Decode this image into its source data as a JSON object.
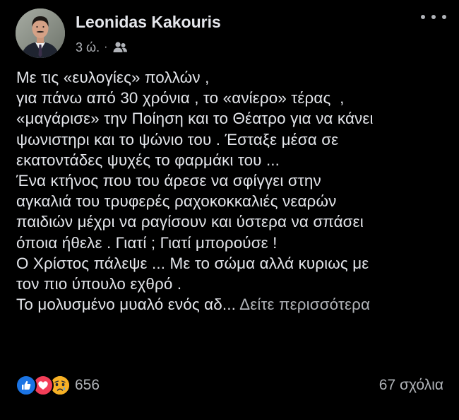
{
  "author": {
    "name": "Leonidas Kakouris",
    "time": "3 ώ.",
    "separator": "·",
    "audience_icon": "friends-icon"
  },
  "header": {
    "more_icon": "more-horizontal-icon"
  },
  "post": {
    "lines": [
      "Με τις «ευλογίες» πολλών ,",
      "για πάνω από 30 χρόνια , το «ανίερο» τέρας  ,",
      "«μαγάρισε» την Ποίηση και το Θέατρο για να κάνει",
      "ψωνιστηρι και το ψώνιο του . Έσταξε μέσα σε",
      "εκατοντάδες ψυχές το φαρμάκι του ...",
      "Ένα κτήνος που του άρεσε να σφίγγει στην",
      "αγκαλιά του τρυφερές ραχοκοκκαλιές νεαρών",
      "παιδιών μέχρι να ραγίσουν και ύστερα να σπάσει",
      "όποια ήθελε . Γιατί ; Γιατί μπορούσε !",
      "Ο Χρίστος πάλεψε ... Με το σώμα αλλά κυριως με",
      "τον πιο ύπουλο εχθρό .",
      "Το μολυσμένο μυαλό ενός αδ..."
    ],
    "see_more": "Δείτε περισσότερα"
  },
  "footer": {
    "reaction_icons": [
      "like-icon",
      "love-icon",
      "sad-icon"
    ],
    "reaction_count": "656",
    "comments": "67 σχόλια"
  },
  "colors": {
    "background": "#000000",
    "text": "#e4e6eb",
    "secondary": "#b0b3b8",
    "like": "#1b74e4",
    "love": "#f33e58",
    "sad": "#f7b125"
  }
}
